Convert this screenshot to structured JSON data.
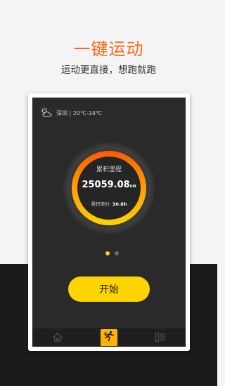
{
  "promo": {
    "title": "一键运动",
    "subtitle": "运动更直接，想跑就跑"
  },
  "weather": {
    "icon": "cloud-sun-icon",
    "city": "深圳",
    "range": "20℃-24℃",
    "text": "深圳 | 20℃-24℃"
  },
  "stats": {
    "label": "累积里程",
    "distance_value": "25059.08",
    "distance_unit": "KM",
    "time_label": "累积用时:",
    "time_value": "30.8h"
  },
  "pager": {
    "count": 2,
    "active_index": 0
  },
  "actions": {
    "start_label": "开始"
  },
  "tabbar": {
    "items": [
      {
        "name": "home",
        "icon": "home-icon",
        "active": false
      },
      {
        "name": "run",
        "icon": "runner-icon",
        "active": true
      },
      {
        "name": "list",
        "icon": "list-icon",
        "active": false
      }
    ]
  },
  "colors": {
    "accent_orange": "#ff6a1a",
    "button_yellow": "#ffd500",
    "ring_start": "#ffd000",
    "ring_end": "#ff5a00",
    "screen_bg": "#2a2a2a",
    "dark_band": "#1b1b1b"
  }
}
